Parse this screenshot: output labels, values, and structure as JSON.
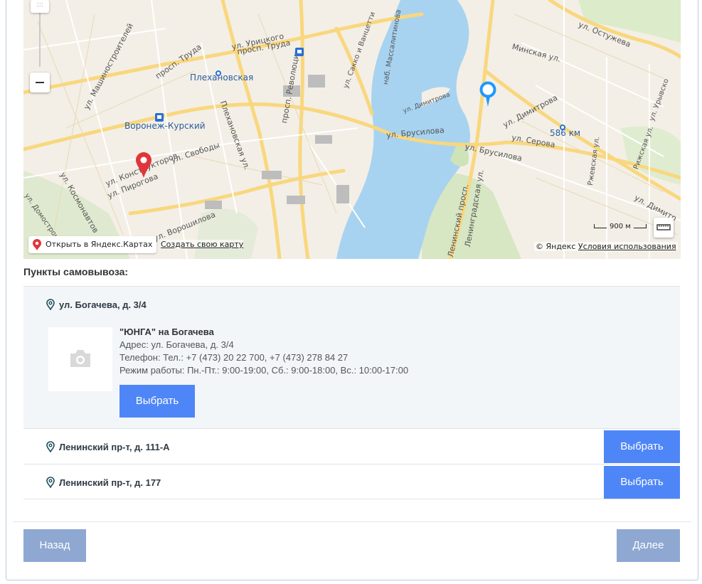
{
  "map": {
    "labels": {
      "plekhanovskaya": "Плехановская",
      "voronezh_kursky": "Воронеж-Курский",
      "svobody": "ул. Свободы",
      "konstruktorov": "ул. Конструкторов",
      "pirogova": "ул. Пирогова",
      "trud": "просп. Труда",
      "trud2": "просп. Труда",
      "uritskogo": "ул. Урицкого",
      "brusilova": "ул. Брусилова",
      "brusilova2": "ул. Брусилова",
      "dimitrova": "ул. Димитрова",
      "dimitrova_small": "ул. Димитрова",
      "dimitrova_right": "ул. Димитр",
      "serova": "ул. Серова",
      "ostuzheva": "ул. Остужева",
      "minskaya": "Минская ул.",
      "km586": "586 км",
      "revolyutsii": "просп. Революции",
      "plekhanovskaya_ul": "Плехановская ул.",
      "voroshilova": "ул. Ворошилова",
      "kosmonavtov": "ул. Космонавтов",
      "mashinostroiteley": "ул. Машиностроителей",
      "leningradskaya": "Ленинградская ул.",
      "leninsky": "Ленинский просп.",
      "massalitinova": "наб. Массалитинова",
      "sakko": "ул. Сакко и Ванцетти",
      "rzhevskaya": "Ржевская ул.",
      "rizhskaya": "Рижская ул.",
      "urevsky": "ул. Урывско",
      "domostroiteley": "ул. Домостроит"
    },
    "zoom_handle_glyph": "::::",
    "open_in_yandex": "Открыть в Яндекс.Картах",
    "create_map": "Создать свою карту",
    "scale_label": "900 м",
    "copyright": "© Яндекс",
    "terms": "Условия использования"
  },
  "pickup": {
    "title": "Пункты самовывоза:",
    "points": [
      {
        "address": "ул. Богачева, д. 3/4",
        "name": "\"ЮНГА\" на Богачева",
        "address_line": "Адрес: ул. Богачева, д. 3/4",
        "phone_line": "Телефон: Тел.: +7 (473) 20 22 700, +7 (473) 278 84 27",
        "hours_line": "Режим работы: Пн.-Пт.: 9:00-19:00, Сб.: 9:00-18:00, Вс.: 10:00-17:00",
        "select_label": "Выбрать"
      },
      {
        "address": "Ленинский пр-т, д. 111-А",
        "select_label": "Выбрать"
      },
      {
        "address": "Ленинский пр-т, д. 177",
        "select_label": "Выбрать"
      }
    ]
  },
  "nav": {
    "back": "Назад",
    "next": "Далее"
  },
  "colors": {
    "primary": "#4f86f7",
    "nav_button": "#8ea8d2",
    "water": "#a7d3f0",
    "road": "#f9d77e"
  }
}
